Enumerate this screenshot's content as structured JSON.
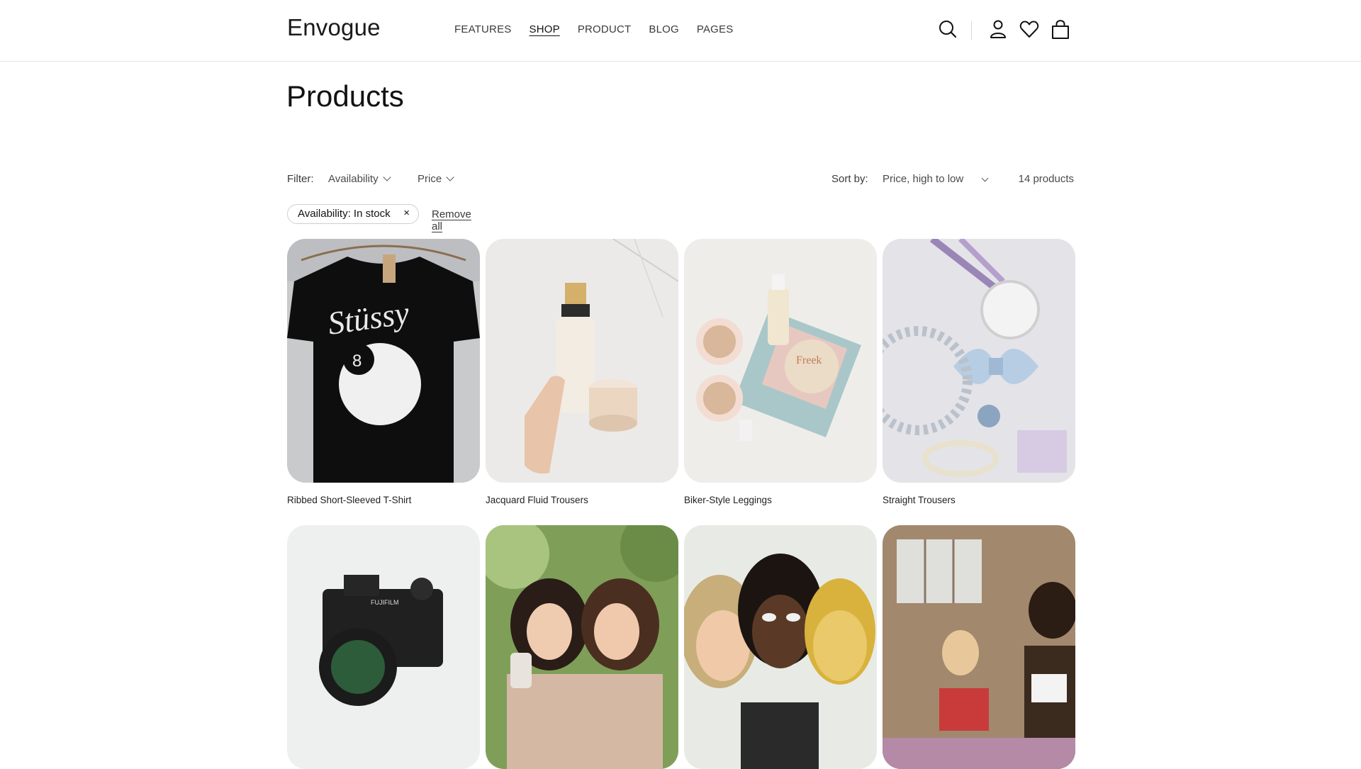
{
  "header": {
    "logo": "Envogue",
    "nav": [
      "FEATURES",
      "SHOP",
      "PRODUCT",
      "BLOG",
      "PAGES"
    ],
    "active_nav": "SHOP",
    "icons": [
      "search-icon",
      "account-icon",
      "wishlist-heart-icon",
      "cart-bag-icon"
    ]
  },
  "page": {
    "title": "Products"
  },
  "filters": {
    "label": "Filter:",
    "availability": "Availability",
    "price": "Price",
    "sort_label": "Sort by:",
    "sort_value": "Price, high to low",
    "count": "14 products",
    "active_filter": "Availability: In stock",
    "active_filter_remove": "×",
    "remove_all": "Remove all"
  },
  "products": [
    {
      "title": "Ribbed Short-Sleeved T-Shirt"
    },
    {
      "title": "Jacquard Fluid Trousers"
    },
    {
      "title": "Biker-Style Leggings"
    },
    {
      "title": "Straight Trousers"
    },
    {
      "title": ""
    },
    {
      "title": ""
    },
    {
      "title": ""
    },
    {
      "title": ""
    }
  ],
  "colors": {
    "text": "#121212",
    "muted": "#4a4a4a",
    "border": "#e6e6e6"
  }
}
